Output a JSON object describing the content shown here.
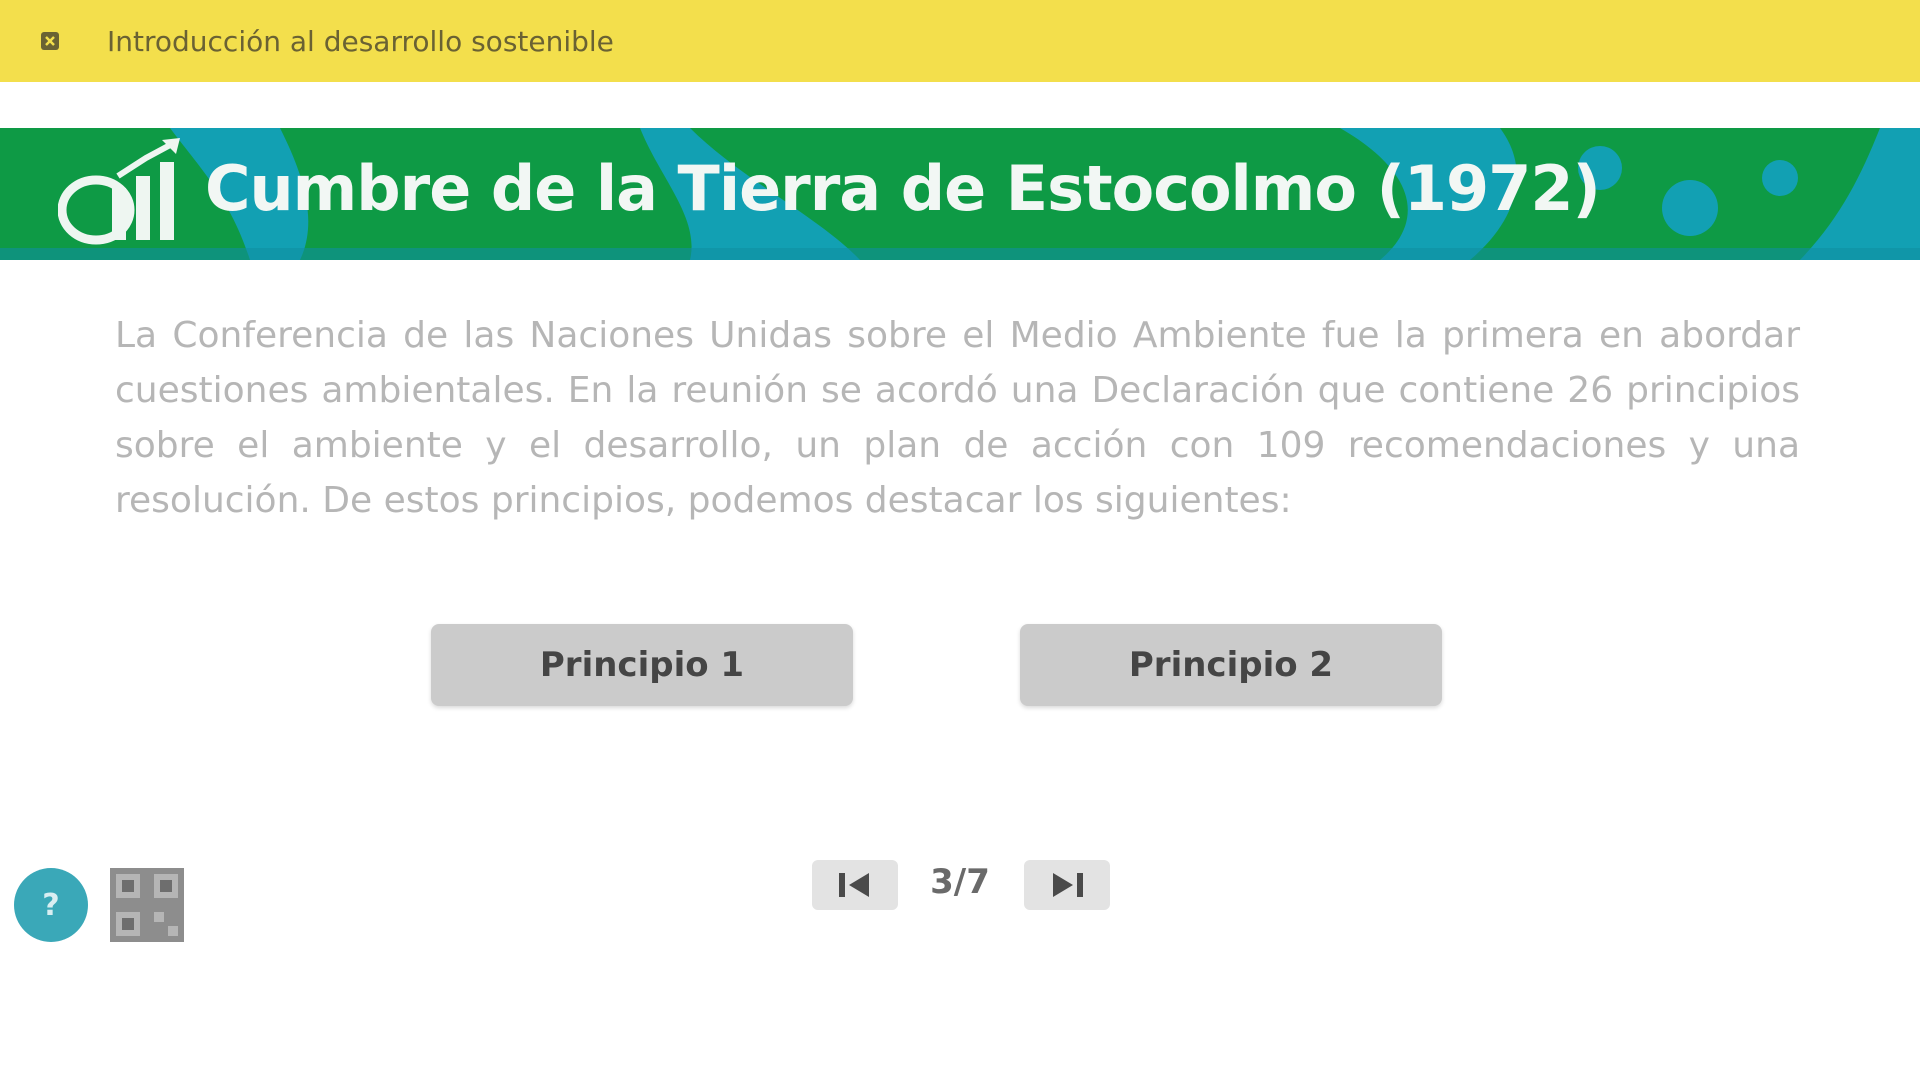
{
  "header": {
    "course_title": "Introducción al desarrollo sostenible",
    "menu_icon": "close-icon",
    "background_color": "#f3df4c"
  },
  "banner": {
    "title": "Cumbre de la Tierra de Estocolmo (1972)",
    "icon": "chart-growth-icon",
    "colors": {
      "blue": "#12a0b3",
      "green": "#0e9a45"
    }
  },
  "content": {
    "intro_text": "La Conferencia de las Naciones Unidas sobre el Medio Ambiente fue la primera en abordar cuestiones ambientales. En la reunión se acordó una Declaración que contiene 26 principios sobre el ambiente y el desarrollo, un plan de acción con 109 recomendaciones y una resolución. De estos principios, podemos destacar los siguientes:"
  },
  "buttons": {
    "principle_1": "Principio 1",
    "principle_2": "Principio 2"
  },
  "pagination": {
    "indicator": "3/7",
    "prev_icon": "chevron-left-icon",
    "next_icon": "chevron-right-icon"
  },
  "footer": {
    "help_label": "?",
    "help_icon": "help-icon",
    "qr_icon": "qr-code-icon",
    "accent_color": "#3aa8b8"
  }
}
